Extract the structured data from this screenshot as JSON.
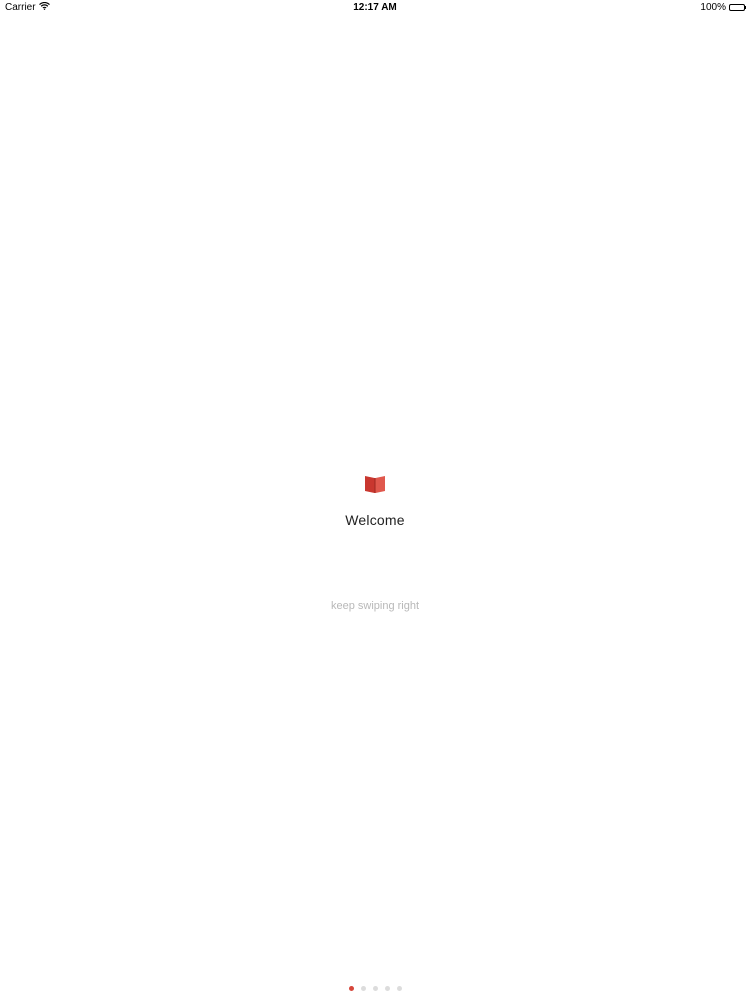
{
  "status_bar": {
    "carrier": "Carrier",
    "time": "12:17 AM",
    "battery": "100%",
    "battery_level": 1.0
  },
  "icons": {
    "wifi": "wifi-icon",
    "battery": "battery-icon",
    "logo": "book-icon"
  },
  "colors": {
    "accent": "#d6463b",
    "inactive_dot": "#dcdcdc"
  },
  "onboarding": {
    "title": "Welcome",
    "hint": "keep swiping right"
  },
  "pager": {
    "total": 5,
    "current": 1
  }
}
